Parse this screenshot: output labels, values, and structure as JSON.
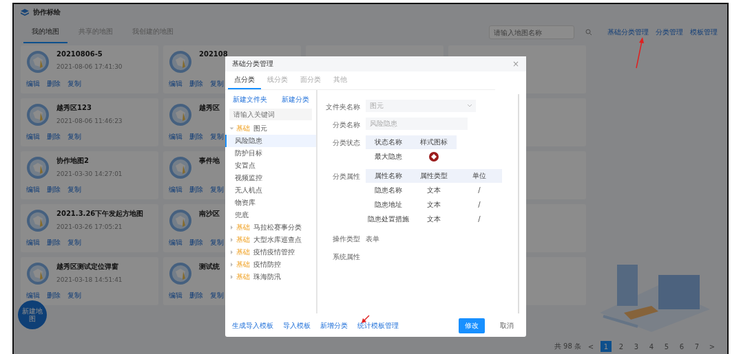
{
  "app": {
    "title": "协作标绘"
  },
  "tabs": [
    {
      "label": "我的地图",
      "selected": true
    },
    {
      "label": "共享的地图",
      "selected": false
    },
    {
      "label": "我创建的地图",
      "selected": false
    }
  ],
  "search": {
    "placeholder": "请输入地图名称"
  },
  "top_links": [
    "基础分类管理",
    "分类管理",
    "模板管理"
  ],
  "cards": [
    {
      "title": "20210806-5",
      "subtitle": "2021-08-06 17:41:30",
      "actions": [
        "编辑",
        "删除",
        "复制"
      ]
    },
    {
      "title": "202108",
      "actions": [
        "编辑",
        "删除",
        "复制"
      ]
    },
    {
      "title": "越秀区123",
      "subtitle": "2021-08-06 11:46:23",
      "actions": [
        "编辑",
        "删除",
        "复制"
      ]
    },
    {
      "title": "越秀区",
      "actions": [
        "编辑",
        "删除",
        "复制"
      ]
    },
    {
      "title": "协作地图2",
      "subtitle": "2021-03-30 14:27:01",
      "actions": [
        "编辑",
        "删除",
        "复制"
      ]
    },
    {
      "title": "事件地",
      "actions": [
        "编辑",
        "删除",
        "复制"
      ]
    },
    {
      "title": "2021.3.26下午发起方地图",
      "subtitle": "2021-03-26 17:05:21",
      "actions": [
        "编辑",
        "删除",
        "复制"
      ]
    },
    {
      "title": "南沙区",
      "actions": [
        "编辑",
        "删除",
        "复制"
      ]
    },
    {
      "title": "越秀区测试定位弹窗",
      "subtitle": "2021-03-18 14:51:41",
      "actions": [
        "编辑",
        "删除",
        "复制"
      ]
    },
    {
      "title": "测试统",
      "actions": [
        "编辑",
        "删除",
        "复制"
      ]
    }
  ],
  "fab": {
    "label": "新建地图"
  },
  "pagination": {
    "total": "共 98 条",
    "prev": "<",
    "pages": [
      {
        "label": "1",
        "selected": true
      },
      {
        "label": "2",
        "selected": false
      },
      {
        "label": "3",
        "selected": false
      },
      {
        "label": "4",
        "selected": false
      },
      {
        "label": "5",
        "selected": false
      },
      {
        "label": "6",
        "selected": false
      },
      {
        "label": "7",
        "selected": false
      }
    ],
    "next": ">"
  },
  "dialog": {
    "title": "基础分类管理",
    "close": "×",
    "tabs": [
      {
        "label": "点分类",
        "selected": true
      },
      {
        "label": "线分类",
        "selected": false
      },
      {
        "label": "面分类",
        "selected": false
      },
      {
        "label": "其他",
        "selected": false
      }
    ],
    "left_actions": [
      "新建文件夹",
      "新建分类"
    ],
    "tree_search": {
      "placeholder": "请输入关键词"
    },
    "tree": [
      {
        "tag": "基础",
        "label": "图元",
        "expanded": true,
        "children": [
          {
            "label": "风险隐患",
            "selected": true
          },
          {
            "label": "防护目标",
            "selected": false
          },
          {
            "label": "安置点",
            "selected": false
          },
          {
            "label": "视频监控",
            "selected": false
          },
          {
            "label": "无人机点",
            "selected": false
          },
          {
            "label": "物资库",
            "selected": false
          },
          {
            "label": "兜底",
            "selected": false
          }
        ]
      },
      {
        "tag": "基础",
        "label": "马拉松赛事分类",
        "expanded": false
      },
      {
        "tag": "基础",
        "label": "大型水库巡查点",
        "expanded": false
      },
      {
        "tag": "基础",
        "label": "疫情疫情管控",
        "expanded": false
      },
      {
        "tag": "基础",
        "label": "疫情防控",
        "expanded": false
      },
      {
        "tag": "基础",
        "label": "珠海防汛",
        "expanded": false
      }
    ],
    "folder_label": "文件夹名称",
    "folder_value": "图元",
    "name_label": "分类名称",
    "name_value": "风险隐患",
    "status_label": "分类状态",
    "status_columns": [
      "状态名称",
      "样式图标"
    ],
    "status_rows": [
      {
        "name": "最大隐患"
      }
    ],
    "attr_label": "分类属性",
    "attr_columns": [
      "属性名称",
      "属性类型",
      "单位"
    ],
    "attr_rows": [
      [
        "隐患名称",
        "文本",
        "/"
      ],
      [
        "隐患地址",
        "文本",
        "/"
      ],
      [
        "隐患处置措施",
        "文本",
        "/"
      ]
    ],
    "op_label": "操作类型",
    "op_value": "表单",
    "system_label": "系统属性",
    "footer_links": [
      "生成导入模板",
      "导入模板",
      "新增分类",
      "统计模板管理"
    ],
    "primary": "修改",
    "cancel": "取消"
  }
}
